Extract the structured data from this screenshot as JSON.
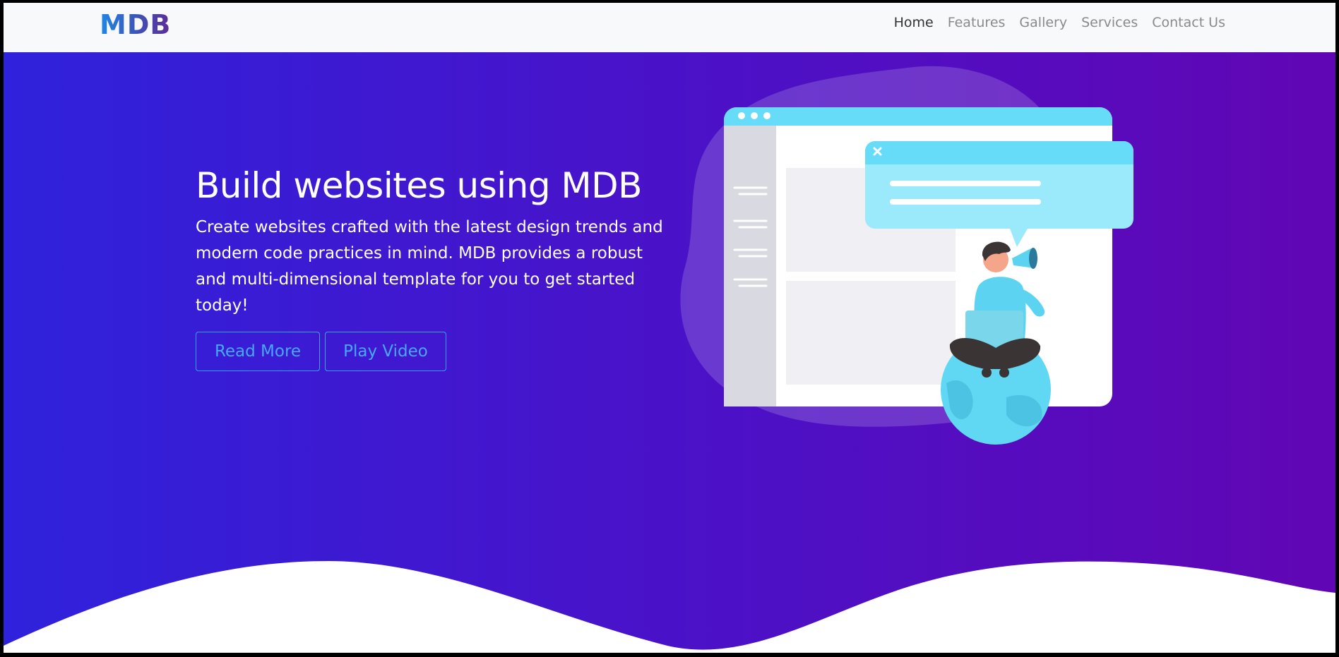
{
  "brand": {
    "logo_text": "MDB"
  },
  "nav": {
    "items": [
      {
        "label": "Home",
        "active": true
      },
      {
        "label": "Features",
        "active": false
      },
      {
        "label": "Gallery",
        "active": false
      },
      {
        "label": "Services",
        "active": false
      },
      {
        "label": "Contact Us",
        "active": false
      }
    ]
  },
  "hero": {
    "title": "Build websites using MDB",
    "description": "Create websites crafted with the latest design trends and modern code practices in mind. MDB provides a robust and multi-dimensional template for you to get started today!",
    "buttons": {
      "read_more": "Read More",
      "play_video": "Play Video"
    },
    "illustration_icon": "person-with-megaphone-on-globe-illustration"
  },
  "colors": {
    "gradient_start": "#2f22dc",
    "gradient_end": "#6106b4",
    "button_accent": "#48a8ff",
    "navbar_bg": "#f8f9fa"
  }
}
